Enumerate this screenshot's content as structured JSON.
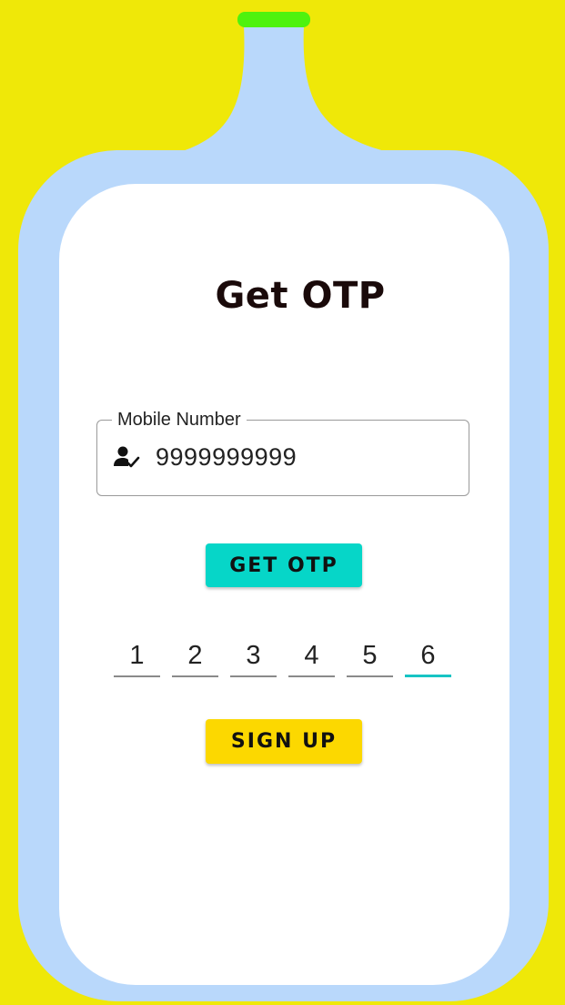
{
  "colors": {
    "background": "#efe808",
    "bottle": "#b9d8fb",
    "cap": "#4ef20e",
    "card": "#ffffff",
    "get_otp_button": "#06d6c8",
    "sign_up_button": "#fcd800",
    "active_digit_underline": "#17c4c4"
  },
  "page": {
    "title": "Get OTP"
  },
  "mobile_field": {
    "label": "Mobile Number",
    "value": "9999999999",
    "icon": "person-check-icon"
  },
  "get_otp_button": {
    "label": "GET OTP"
  },
  "otp": {
    "digits": [
      "1",
      "2",
      "3",
      "4",
      "5",
      "6"
    ],
    "active_index": 5
  },
  "sign_up_button": {
    "label": "SIGN UP"
  }
}
